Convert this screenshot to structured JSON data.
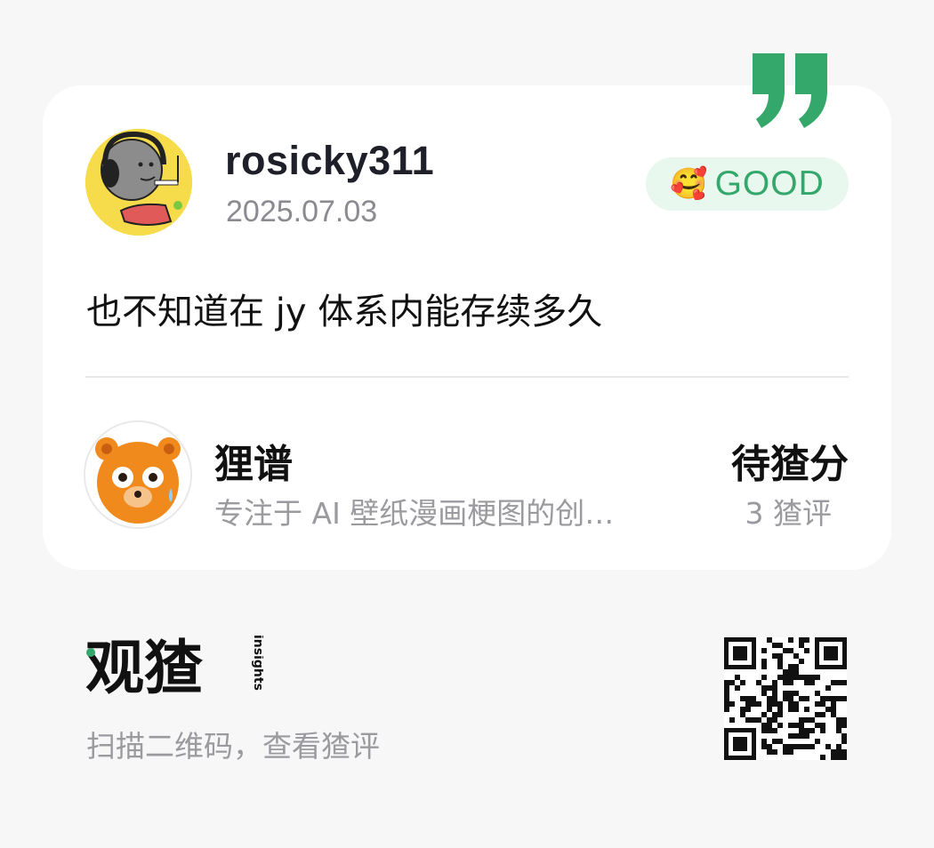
{
  "review": {
    "username": "rosicky311",
    "date": "2025.07.03",
    "badge_emoji": "🥰",
    "badge_label": "GOOD",
    "text": "也不知道在 jy 体系内能存续多久"
  },
  "product": {
    "name": "狸谱",
    "description": "专注于 AI 壁纸漫画梗图的创…",
    "score_label": "待猹分",
    "review_count": "3 猹评"
  },
  "footer": {
    "brand_name": "观猹",
    "brand_sub": "insights",
    "scan_text": "扫描二维码，查看猹评"
  },
  "colors": {
    "accent": "#34a86a",
    "badge_bg": "#e9f8ef",
    "card_bg": "#ffffff",
    "page_bg": "#f7f7f7"
  },
  "icons": {
    "quote": "quote-mark-icon",
    "qr": "qr-code-icon"
  }
}
